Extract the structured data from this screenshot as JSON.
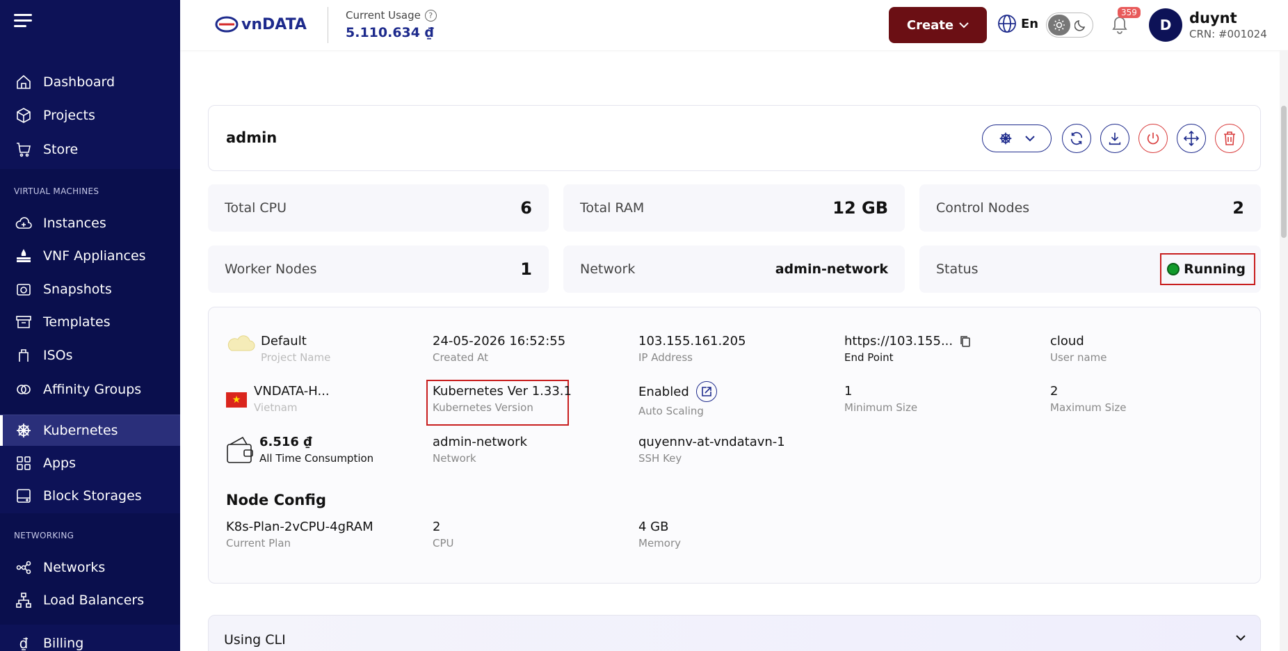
{
  "sidebar": {
    "items_top": [
      {
        "label": "Dashboard",
        "icon": "home-icon"
      },
      {
        "label": "Projects",
        "icon": "cube-icon"
      },
      {
        "label": "Store",
        "icon": "cart-icon"
      }
    ],
    "vm_heading": "VIRTUAL MACHINES",
    "vm_items": [
      {
        "label": "Instances",
        "icon": "cloud-icon"
      },
      {
        "label": "VNF Appliances",
        "icon": "firewall-icon"
      },
      {
        "label": "Snapshots",
        "icon": "camera-icon"
      },
      {
        "label": "Templates",
        "icon": "archive-icon"
      },
      {
        "label": "ISOs",
        "icon": "iso-icon"
      },
      {
        "label": "Affinity Groups",
        "icon": "affinity-icon"
      }
    ],
    "k8s_items": [
      {
        "label": "Kubernetes",
        "icon": "kubernetes-icon",
        "active": true
      },
      {
        "label": "Apps",
        "icon": "apps-icon"
      },
      {
        "label": "Block Storages",
        "icon": "storage-icon"
      }
    ],
    "net_heading": "NETWORKING",
    "net_items": [
      {
        "label": "Networks",
        "icon": "network-icon"
      },
      {
        "label": "Load Balancers",
        "icon": "loadbalancer-icon"
      }
    ],
    "billing": {
      "label": "Billing",
      "icon": "billing-icon"
    }
  },
  "topbar": {
    "logo_text": "vnDATA",
    "usage_label": "Current Usage",
    "usage_value": "5.110.634 ₫",
    "create_label": "Create",
    "lang": "En",
    "notifications": "359",
    "avatar_initial": "D",
    "user_name": "duynt",
    "crn": "CRN: #001024"
  },
  "cluster": {
    "title": "admin",
    "stats": {
      "total_cpu_label": "Total CPU",
      "total_cpu": "6",
      "total_ram_label": "Total RAM",
      "total_ram": "12 GB",
      "control_label": "Control Nodes",
      "control": "2",
      "worker_label": "Worker Nodes",
      "worker": "1",
      "network_label": "Network",
      "network": "admin-network",
      "status_label": "Status",
      "status": "Running"
    },
    "details": {
      "project_value": "Default",
      "project_label": "Project Name",
      "created_value": "24-05-2026 16:52:55",
      "created_label": "Created At",
      "ip_value": "103.155.161.205",
      "ip_label": "IP Address",
      "endpoint_value": "https://103.155...",
      "endpoint_label": "End Point",
      "user_value": "cloud",
      "user_label": "User name",
      "zone_value": "VNDATA-H...",
      "zone_label": "Vietnam",
      "kver_value": "Kubernetes Ver 1.33.1",
      "kver_label": "Kubernetes Version",
      "autoscale_value": "Enabled",
      "autoscale_label": "Auto Scaling",
      "min_value": "1",
      "min_label": "Minimum Size",
      "max_value": "2",
      "max_label": "Maximum Size",
      "consumption_value": "6.516 ₫",
      "consumption_label": "All Time Consumption",
      "network_value": "admin-network",
      "network_label": "Network",
      "ssh_value": "quyennv-at-vndatavn-1",
      "ssh_label": "SSH Key"
    },
    "node_config": {
      "title": "Node Config",
      "plan_value": "K8s-Plan-2vCPU-4gRAM",
      "plan_label": "Current Plan",
      "cpu_value": "2",
      "cpu_label": "CPU",
      "mem_value": "4 GB",
      "mem_label": "Memory"
    },
    "cli_title": "Using CLI"
  },
  "colors": {
    "sidebar": "#0d1257",
    "accent": "#1d2a8c",
    "create": "#6b0f14",
    "danger": "#c81e1e",
    "running": "#119a2a"
  }
}
